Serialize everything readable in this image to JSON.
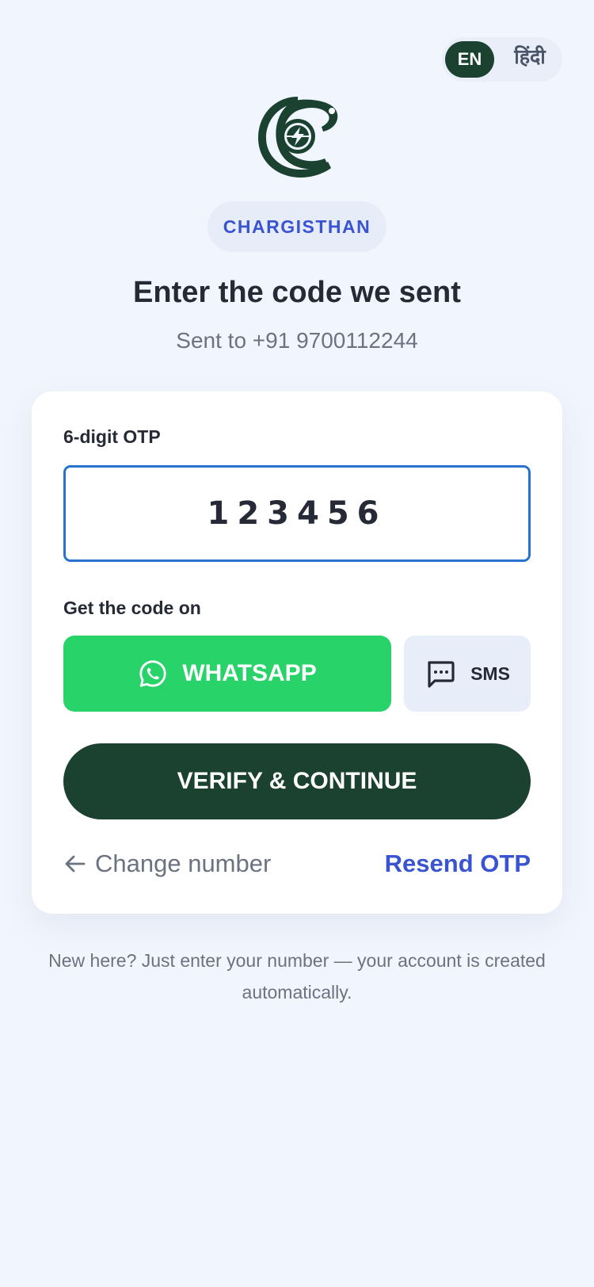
{
  "language_toggle": {
    "options": [
      {
        "label": "EN",
        "selected": true
      },
      {
        "label": "हिंदी",
        "selected": false
      }
    ]
  },
  "logo": {
    "icon": "chargisthan-logo-icon"
  },
  "brand": {
    "name": "CHARGISTHAN"
  },
  "header": {
    "title": "Enter the code we sent",
    "subtitle": "Sent to +91 9700112244"
  },
  "otp": {
    "label": "6-digit OTP",
    "value": "123456"
  },
  "delivery": {
    "label": "Get the code on",
    "whatsapp": {
      "label": "WHATSAPP",
      "icon": "whatsapp-icon"
    },
    "sms": {
      "label": "SMS",
      "icon": "message-icon"
    }
  },
  "actions": {
    "verify_label": "VERIFY & CONTINUE",
    "change_number_label": "Change number",
    "resend_label": "Resend OTP"
  },
  "footer": {
    "note": "New here? Just enter your number — your account is created automatically."
  },
  "colors": {
    "background": "#f1f5fd",
    "primary_dark_green": "#1b4230",
    "whatsapp_green": "#28d369",
    "accent_blue": "#3a53d0",
    "input_border_blue": "#2773cf"
  }
}
